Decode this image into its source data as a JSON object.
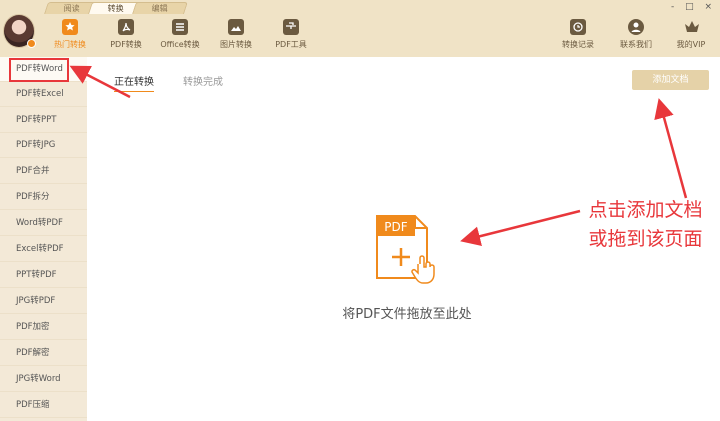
{
  "window": {
    "controls": "- □ ×"
  },
  "mode_tabs": [
    {
      "label": "阅读"
    },
    {
      "label": "转换"
    },
    {
      "label": "编辑"
    }
  ],
  "toolbar": {
    "left": [
      {
        "label": "热门转换",
        "icon": "star-icon"
      },
      {
        "label": "PDF转换",
        "icon": "pdf-icon"
      },
      {
        "label": "Office转换",
        "icon": "document-icon"
      },
      {
        "label": "图片转换",
        "icon": "image-icon"
      },
      {
        "label": "PDF工具",
        "icon": "toolbox-icon"
      }
    ],
    "right": [
      {
        "label": "转换记录",
        "icon": "history-icon"
      },
      {
        "label": "联系我们",
        "icon": "contact-icon"
      },
      {
        "label": "我的VIP",
        "icon": "crown-icon"
      }
    ]
  },
  "sidebar": {
    "items": [
      {
        "label": "PDF转Word"
      },
      {
        "label": "PDF转Excel"
      },
      {
        "label": "PDF转PPT"
      },
      {
        "label": "PDF转JPG"
      },
      {
        "label": "PDF合并"
      },
      {
        "label": "PDF拆分"
      },
      {
        "label": "Word转PDF"
      },
      {
        "label": "Excel转PDF"
      },
      {
        "label": "PPT转PDF"
      },
      {
        "label": "JPG转PDF"
      },
      {
        "label": "PDF加密"
      },
      {
        "label": "PDF解密"
      },
      {
        "label": "JPG转Word"
      },
      {
        "label": "PDF压缩"
      }
    ]
  },
  "main": {
    "tabs": [
      {
        "label": "正在转换"
      },
      {
        "label": "转换完成"
      }
    ],
    "add_button": "添加文档",
    "drop_icon_label": "PDF",
    "drop_text": "将PDF文件拖放至此处"
  },
  "annotation": {
    "line1": "点击添加文档",
    "line2": "或拖到该页面"
  },
  "colors": {
    "accent": "#f08a1c",
    "header_bg": "#f0e3c6",
    "sidebar_bg": "#f3e9d7",
    "annotation": "#e8373b"
  }
}
